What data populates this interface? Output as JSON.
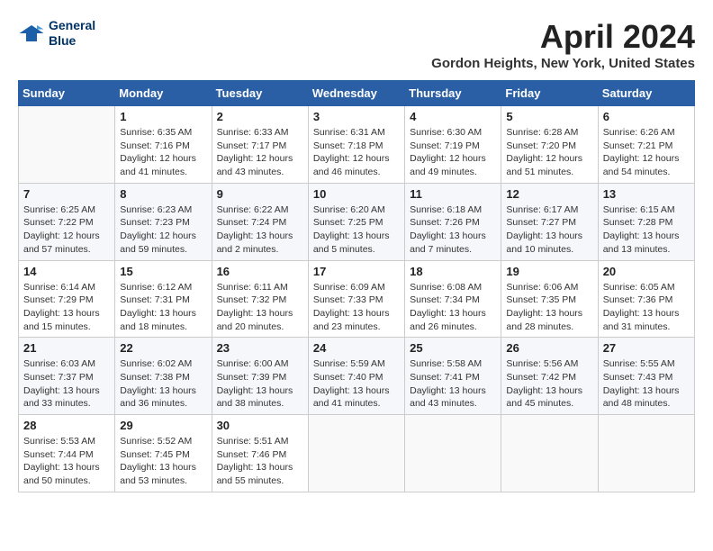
{
  "header": {
    "logo_line1": "General",
    "logo_line2": "Blue",
    "month_title": "April 2024",
    "location": "Gordon Heights, New York, United States"
  },
  "weekdays": [
    "Sunday",
    "Monday",
    "Tuesday",
    "Wednesday",
    "Thursday",
    "Friday",
    "Saturday"
  ],
  "weeks": [
    [
      {
        "day": "",
        "info": ""
      },
      {
        "day": "1",
        "info": "Sunrise: 6:35 AM\nSunset: 7:16 PM\nDaylight: 12 hours\nand 41 minutes."
      },
      {
        "day": "2",
        "info": "Sunrise: 6:33 AM\nSunset: 7:17 PM\nDaylight: 12 hours\nand 43 minutes."
      },
      {
        "day": "3",
        "info": "Sunrise: 6:31 AM\nSunset: 7:18 PM\nDaylight: 12 hours\nand 46 minutes."
      },
      {
        "day": "4",
        "info": "Sunrise: 6:30 AM\nSunset: 7:19 PM\nDaylight: 12 hours\nand 49 minutes."
      },
      {
        "day": "5",
        "info": "Sunrise: 6:28 AM\nSunset: 7:20 PM\nDaylight: 12 hours\nand 51 minutes."
      },
      {
        "day": "6",
        "info": "Sunrise: 6:26 AM\nSunset: 7:21 PM\nDaylight: 12 hours\nand 54 minutes."
      }
    ],
    [
      {
        "day": "7",
        "info": "Sunrise: 6:25 AM\nSunset: 7:22 PM\nDaylight: 12 hours\nand 57 minutes."
      },
      {
        "day": "8",
        "info": "Sunrise: 6:23 AM\nSunset: 7:23 PM\nDaylight: 12 hours\nand 59 minutes."
      },
      {
        "day": "9",
        "info": "Sunrise: 6:22 AM\nSunset: 7:24 PM\nDaylight: 13 hours\nand 2 minutes."
      },
      {
        "day": "10",
        "info": "Sunrise: 6:20 AM\nSunset: 7:25 PM\nDaylight: 13 hours\nand 5 minutes."
      },
      {
        "day": "11",
        "info": "Sunrise: 6:18 AM\nSunset: 7:26 PM\nDaylight: 13 hours\nand 7 minutes."
      },
      {
        "day": "12",
        "info": "Sunrise: 6:17 AM\nSunset: 7:27 PM\nDaylight: 13 hours\nand 10 minutes."
      },
      {
        "day": "13",
        "info": "Sunrise: 6:15 AM\nSunset: 7:28 PM\nDaylight: 13 hours\nand 13 minutes."
      }
    ],
    [
      {
        "day": "14",
        "info": "Sunrise: 6:14 AM\nSunset: 7:29 PM\nDaylight: 13 hours\nand 15 minutes."
      },
      {
        "day": "15",
        "info": "Sunrise: 6:12 AM\nSunset: 7:31 PM\nDaylight: 13 hours\nand 18 minutes."
      },
      {
        "day": "16",
        "info": "Sunrise: 6:11 AM\nSunset: 7:32 PM\nDaylight: 13 hours\nand 20 minutes."
      },
      {
        "day": "17",
        "info": "Sunrise: 6:09 AM\nSunset: 7:33 PM\nDaylight: 13 hours\nand 23 minutes."
      },
      {
        "day": "18",
        "info": "Sunrise: 6:08 AM\nSunset: 7:34 PM\nDaylight: 13 hours\nand 26 minutes."
      },
      {
        "day": "19",
        "info": "Sunrise: 6:06 AM\nSunset: 7:35 PM\nDaylight: 13 hours\nand 28 minutes."
      },
      {
        "day": "20",
        "info": "Sunrise: 6:05 AM\nSunset: 7:36 PM\nDaylight: 13 hours\nand 31 minutes."
      }
    ],
    [
      {
        "day": "21",
        "info": "Sunrise: 6:03 AM\nSunset: 7:37 PM\nDaylight: 13 hours\nand 33 minutes."
      },
      {
        "day": "22",
        "info": "Sunrise: 6:02 AM\nSunset: 7:38 PM\nDaylight: 13 hours\nand 36 minutes."
      },
      {
        "day": "23",
        "info": "Sunrise: 6:00 AM\nSunset: 7:39 PM\nDaylight: 13 hours\nand 38 minutes."
      },
      {
        "day": "24",
        "info": "Sunrise: 5:59 AM\nSunset: 7:40 PM\nDaylight: 13 hours\nand 41 minutes."
      },
      {
        "day": "25",
        "info": "Sunrise: 5:58 AM\nSunset: 7:41 PM\nDaylight: 13 hours\nand 43 minutes."
      },
      {
        "day": "26",
        "info": "Sunrise: 5:56 AM\nSunset: 7:42 PM\nDaylight: 13 hours\nand 45 minutes."
      },
      {
        "day": "27",
        "info": "Sunrise: 5:55 AM\nSunset: 7:43 PM\nDaylight: 13 hours\nand 48 minutes."
      }
    ],
    [
      {
        "day": "28",
        "info": "Sunrise: 5:53 AM\nSunset: 7:44 PM\nDaylight: 13 hours\nand 50 minutes."
      },
      {
        "day": "29",
        "info": "Sunrise: 5:52 AM\nSunset: 7:45 PM\nDaylight: 13 hours\nand 53 minutes."
      },
      {
        "day": "30",
        "info": "Sunrise: 5:51 AM\nSunset: 7:46 PM\nDaylight: 13 hours\nand 55 minutes."
      },
      {
        "day": "",
        "info": ""
      },
      {
        "day": "",
        "info": ""
      },
      {
        "day": "",
        "info": ""
      },
      {
        "day": "",
        "info": ""
      }
    ]
  ]
}
